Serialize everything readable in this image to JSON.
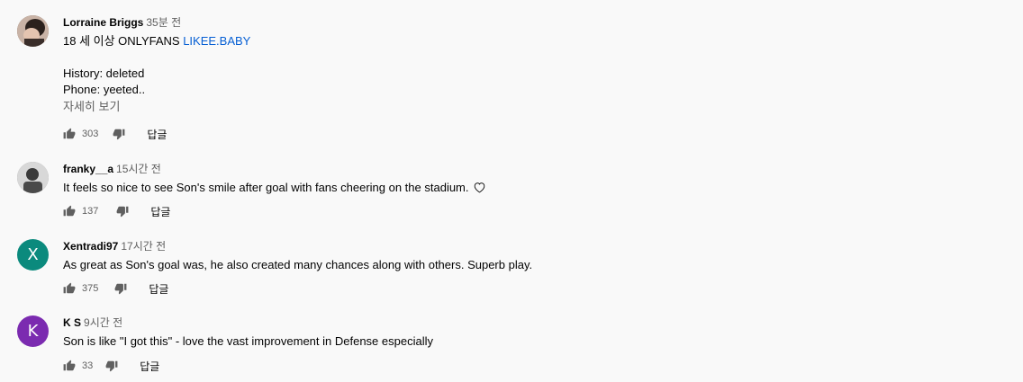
{
  "comments": [
    {
      "author": "Lorraine Briggs",
      "time": "35분 전",
      "lines": [
        "18 세 이상 ONLYFANS",
        "LIKEE.BABY",
        "History: deleted",
        "Phone: yeeted.."
      ],
      "more": "자세히 보기",
      "likes": "303",
      "reply": "답글",
      "avatar_color": "#6b5a50"
    },
    {
      "author": "franky__a",
      "time": "15시간 전",
      "text": "It feels so nice to see Son's smile after goal with fans cheering on the stadium.",
      "likes": "137",
      "reply": "답글",
      "avatar_color": "#8a8a8a"
    },
    {
      "author": "Xentradi97",
      "time": "17시간 전",
      "avatar_letter": "X",
      "avatar_color": "#0b8a7d",
      "text": "As great as Son's goal was, he also created many chances along with others.  Superb play.",
      "likes": "375",
      "reply": "답글"
    },
    {
      "author": "K S",
      "time": "9시간 전",
      "avatar_letter": "K",
      "avatar_color": "#7b2bb0",
      "text": "Son is like \"I got this\" - love the vast improvement in Defense especially",
      "likes": "33",
      "reply": "답글"
    }
  ],
  "icons": {
    "like": "thumb-up-icon",
    "dislike": "thumb-down-icon",
    "heart": "heart-icon"
  }
}
